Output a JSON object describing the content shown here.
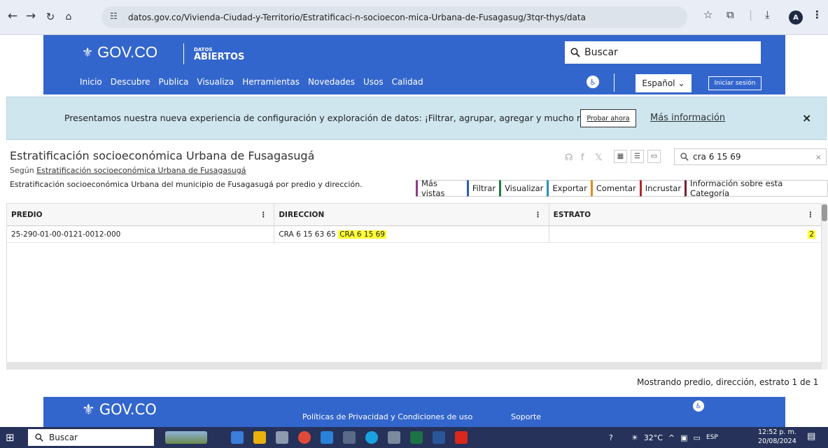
{
  "browser": {
    "url": "datos.gov.co/Vivienda-Ciudad-y-Territorio/Estratificaci-n-socioecon-mica-Urbana-de-Fusagasug/3tqr-thys/data",
    "profile_initial": "A"
  },
  "site": {
    "logo": "GOV.CO",
    "datos_small": "DATOS",
    "datos_big": "ABIERTOS",
    "search_placeholder": "Buscar",
    "menu": [
      "Inicio",
      "Descubre",
      "Publica",
      "Visualiza",
      "Herramientas",
      "Novedades",
      "Usos",
      "Calidad"
    ],
    "language": "Español",
    "login": "Iniciar sesión"
  },
  "banner": {
    "text": "Presentamos nuestra nueva experiencia de configuración y exploración de datos: ¡Filtrar, agrupar, agregar y mucho más!",
    "try_button": "Probar ahora",
    "more_info": "Más información",
    "close": "×"
  },
  "dataset": {
    "title": "Estratificación socioeconómica Urbana de Fusagasugá",
    "segun_prefix": "Según ",
    "segun_link": "Estratificación socioeconómica Urbana de Fusagasugá",
    "description": "Estratificación socioeconómica Urbana del municipio de Fusagasugá por predio y dirección.",
    "search_value": "cra 6 15 69",
    "actions": [
      {
        "label": "Más vistas",
        "color": "#8b3a8f"
      },
      {
        "label": "Filtrar",
        "color": "#2a5db0"
      },
      {
        "label": "Visualizar",
        "color": "#1e7a3c"
      },
      {
        "label": "Exportar",
        "color": "#2a8fc1"
      },
      {
        "label": "Comentar",
        "color": "#e08a1e"
      },
      {
        "label": "Incrustar",
        "color": "#b02a2a"
      },
      {
        "label": "Información sobre esta Categoría",
        "color": "#7a1f2e"
      }
    ]
  },
  "table": {
    "columns": [
      "PREDIO",
      "DIRECCION",
      "ESTRATO"
    ],
    "rows": [
      {
        "predio": "25-290-01-00-0121-0012-000",
        "direccion_prefix": "CRA 6 15 63 65 ",
        "direccion_highlight": "CRA 6 15 69",
        "estrato": "2"
      }
    ],
    "status": "Mostrando predio, dirección, estrato 1 de 1"
  },
  "footer": {
    "logo": "GOV.CO",
    "privacy": "Políticas de Privacidad y Condiciones de uso",
    "support": "Soporte"
  },
  "taskbar": {
    "search": "Buscar",
    "temperature": "32°C",
    "lang": "ESP",
    "time": "12:52 p. m.",
    "date": "20/08/2024"
  }
}
